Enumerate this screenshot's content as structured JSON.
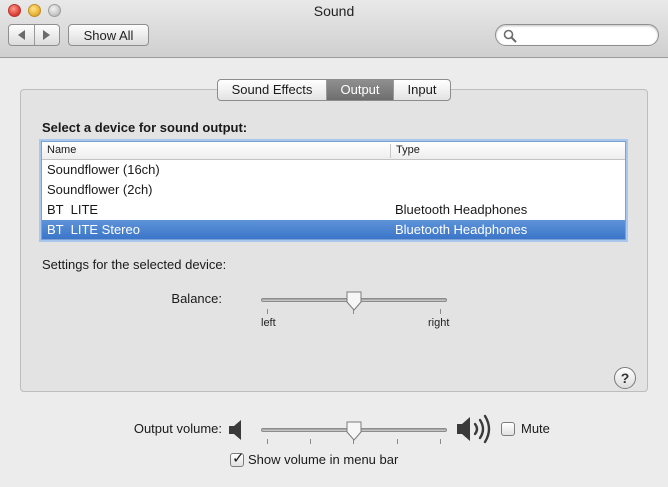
{
  "window": {
    "title": "Sound"
  },
  "toolbar": {
    "show_all_label": "Show All",
    "search_placeholder": "",
    "search_value": ""
  },
  "tabs": [
    {
      "label": "Sound Effects",
      "active": false
    },
    {
      "label": "Output",
      "active": true
    },
    {
      "label": "Input",
      "active": false
    }
  ],
  "output": {
    "section_label": "Select a device for sound output:",
    "columns": {
      "name": "Name",
      "type": "Type"
    },
    "devices": [
      {
        "name": "Soundflower (16ch)",
        "type": "",
        "selected": false
      },
      {
        "name": "Soundflower (2ch)",
        "type": "",
        "selected": false
      },
      {
        "name": "BT  LITE",
        "type": "Bluetooth Headphones",
        "selected": false
      },
      {
        "name": "BT  LITE Stereo",
        "type": "Bluetooth Headphones",
        "selected": true
      }
    ],
    "settings_label": "Settings for the selected device:",
    "balance": {
      "label": "Balance:",
      "left_label": "left",
      "right_label": "right",
      "value": 0.5
    }
  },
  "help_label": "?",
  "volume": {
    "label": "Output volume:",
    "value": 0.5,
    "mute_label": "Mute",
    "mute_checked": false,
    "show_in_menu_bar_label": "Show volume in menu bar",
    "show_in_menu_bar_checked": true
  },
  "colors": {
    "selection": "#3974c8",
    "focus_ring": "#a9c6ec",
    "active_tab": "#7c7c7c"
  }
}
